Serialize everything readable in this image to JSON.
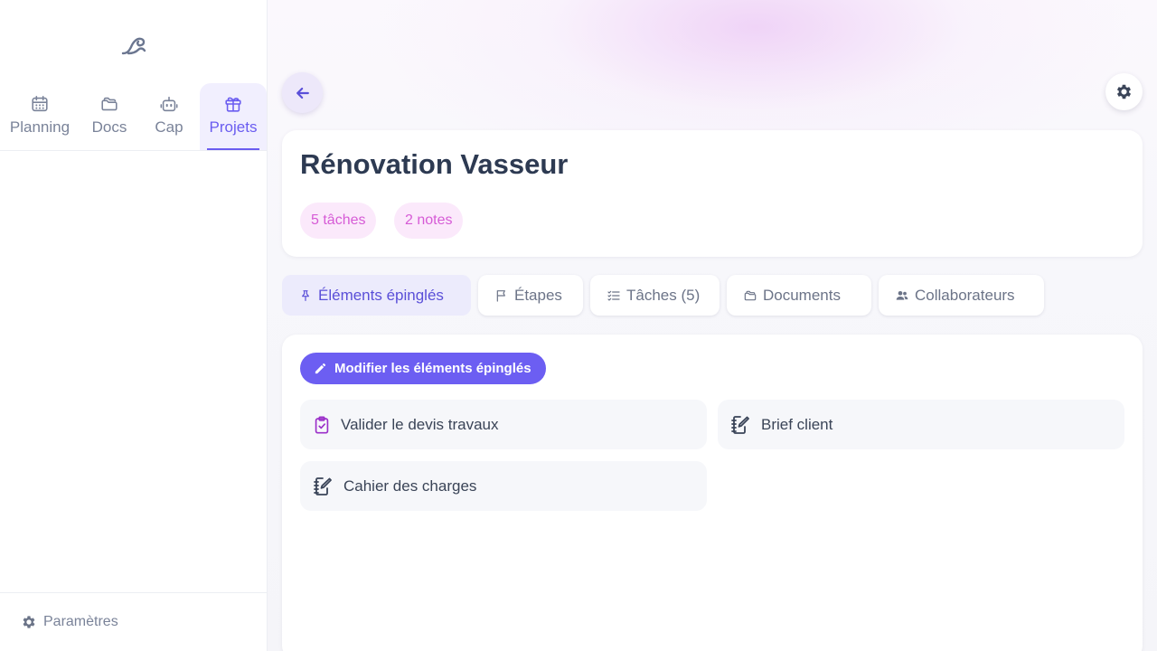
{
  "sidebar": {
    "logo_icon": "wave-logo",
    "nav": [
      {
        "label": "Planning",
        "icon": "calendar-icon"
      },
      {
        "label": "Docs",
        "icon": "folder-icon"
      },
      {
        "label": "Cap",
        "icon": "robot-icon"
      },
      {
        "label": "Projets",
        "icon": "box-icon",
        "active": true
      }
    ],
    "footer": {
      "label": "Paramètres",
      "icon": "gear-icon"
    }
  },
  "project": {
    "title": "Rénovation Vasseur",
    "badges": [
      "5 tâches",
      "2 notes"
    ]
  },
  "tabs": [
    {
      "label": "Éléments épinglés",
      "icon": "pin-icon",
      "active": true
    },
    {
      "label": "Étapes",
      "icon": "flag-icon"
    },
    {
      "label": "Tâches (5)",
      "icon": "checklist-icon"
    },
    {
      "label": "Documents",
      "icon": "folders-icon"
    },
    {
      "label": "Collaborateurs",
      "icon": "users-icon"
    }
  ],
  "pinned": {
    "edit_label": "Modifier les éléments épinglés",
    "items": [
      {
        "label": "Valider le devis travaux",
        "icon": "clipboard-check-icon"
      },
      {
        "label": "Brief client",
        "icon": "notebook-edit-icon"
      },
      {
        "label": "Cahier des charges",
        "icon": "notebook-edit-icon"
      }
    ]
  },
  "colors": {
    "accent": "#6c5ef2",
    "badge_text": "#d65bd6",
    "badge_bg": "#fbe9fb"
  }
}
